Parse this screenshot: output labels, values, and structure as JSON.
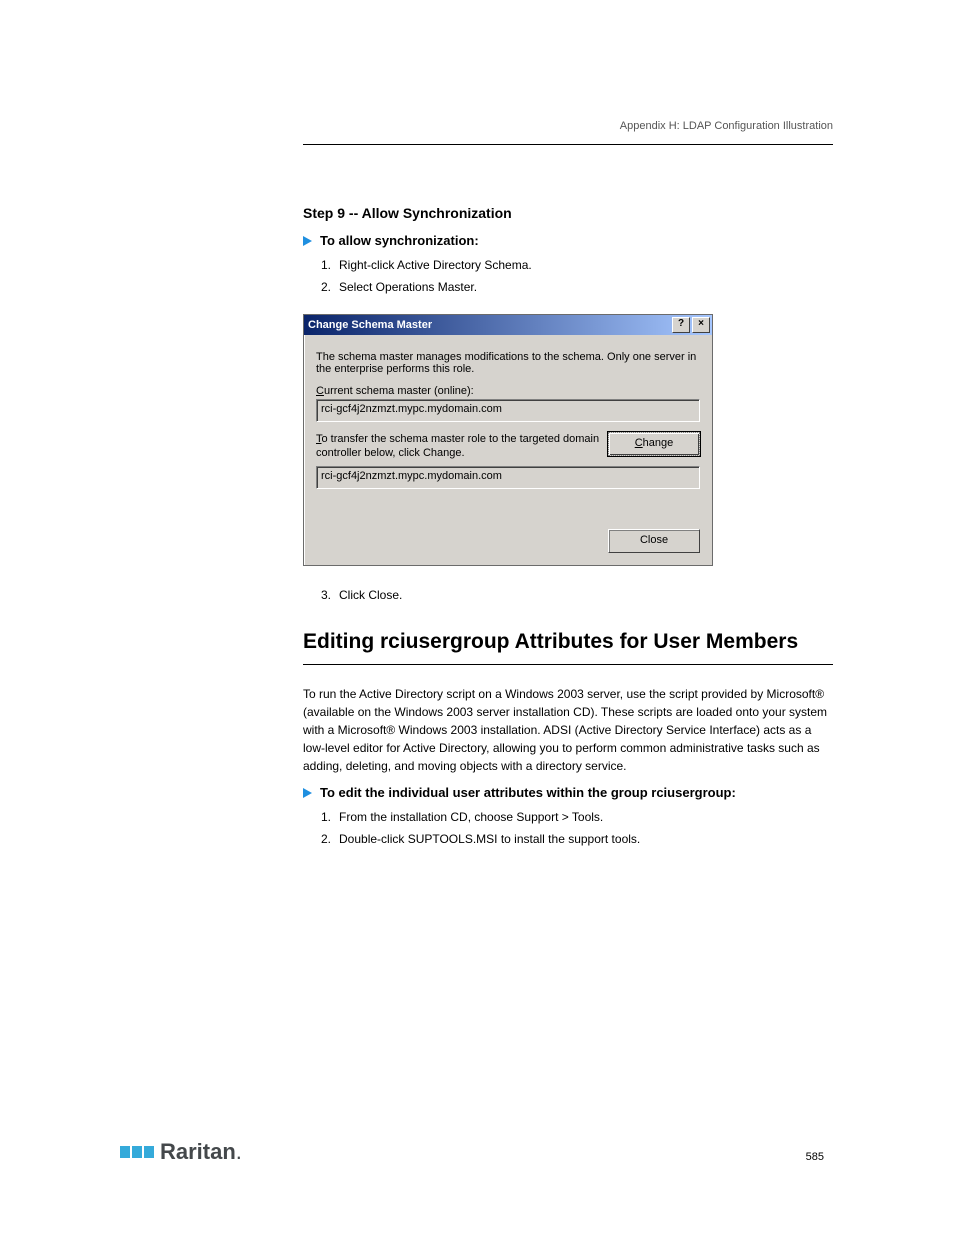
{
  "header": {
    "appendix_line": "Appendix H: LDAP Configuration Illustration"
  },
  "section1": {
    "title": "Step 9 -- Allow Synchronization",
    "arrow_text": "To allow synchronization:",
    "steps": [
      "Right-click Active Directory Schema.",
      "Select Operations Master.",
      "Click Close."
    ]
  },
  "dialog": {
    "title": "Change Schema Master",
    "help_btn": "?",
    "close_btn": "×",
    "msg": "The schema master manages modifications to the schema. Only one server in the enterprise performs this role.",
    "current_label": "Current schema master (online):",
    "current_value": "rci-gcf4j2nzmzt.mypc.mydomain.com",
    "transfer_label": "To transfer the schema master role to the targeted domain controller below, click Change.",
    "change_btn": "Change",
    "target_value": "rci-gcf4j2nzmzt.mypc.mydomain.com",
    "close_dialog_btn": "Close"
  },
  "section2": {
    "heading": "Editing rciusergroup Attributes for User Members",
    "para": "To run the Active Directory script on a Windows 2003 server, use the script provided by Microsoft® (available on the Windows 2003 server installation CD). These scripts are loaded onto your system with a Microsoft® Windows 2003 installation. ADSI (Active Directory Service Interface) acts as a low-level editor for Active Directory, allowing you to perform common administrative tasks such as adding, deleting, and moving objects with a directory service.",
    "arrow_text": "To edit the individual user attributes within the group rciusergroup:",
    "steps": [
      "From the installation CD, choose Support > Tools.",
      "Double-click SUPTOOLS.MSI to install the support tools."
    ]
  },
  "footer": {
    "brand": "Raritan",
    "page_number": "585"
  }
}
